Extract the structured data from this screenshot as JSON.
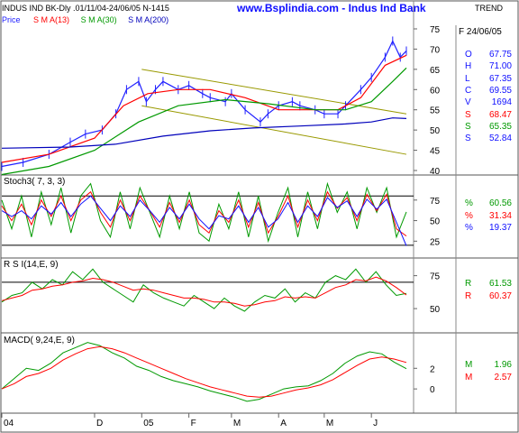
{
  "header": {
    "symbol_line": "INDUS IND BK-Dly .01/11/04-24/06/05  N-1415",
    "site_title": "www.Bsplindia.com - Indus Ind Bank",
    "trend_label": "TREND",
    "legend": [
      {
        "label": "Price",
        "color": "#2020ff"
      },
      {
        "label": "S M A(13)",
        "color": "#ff0000"
      },
      {
        "label": "S M A(30)",
        "color": "#009900"
      },
      {
        "label": "S M A(200)",
        "color": "#0000bb"
      }
    ]
  },
  "readouts": {
    "date": "F 24/06/05",
    "price": [
      {
        "k": "O",
        "v": "67.75",
        "color": "#1010ff"
      },
      {
        "k": "H",
        "v": "71.00",
        "color": "#1010ff"
      },
      {
        "k": "L",
        "v": "67.35",
        "color": "#1010ff"
      },
      {
        "k": "C",
        "v": "69.55",
        "color": "#1010ff"
      },
      {
        "k": "V",
        "v": "1694",
        "color": "#1010ff"
      },
      {
        "k": "S",
        "v": "68.47",
        "color": "#ff0000"
      },
      {
        "k": "S",
        "v": "65.35",
        "color": "#009900"
      },
      {
        "k": "S",
        "v": "52.84",
        "color": "#1010ff"
      }
    ],
    "stoch": [
      {
        "k": "%",
        "v": "60.56",
        "color": "#009900"
      },
      {
        "k": "%",
        "v": "31.34",
        "color": "#ff0000"
      },
      {
        "k": "%",
        "v": "19.37",
        "color": "#1010ff"
      }
    ],
    "rsi": [
      {
        "k": "R",
        "v": "61.53",
        "color": "#009900"
      },
      {
        "k": "R",
        "v": "60.37",
        "color": "#ff0000"
      }
    ],
    "macd": [
      {
        "k": "M",
        "v": "1.96",
        "color": "#009900"
      },
      {
        "k": "M",
        "v": "2.57",
        "color": "#ff0000"
      }
    ]
  },
  "chart_data": [
    {
      "type": "line",
      "panel": "price",
      "title": "www.Bsplindia.com - Indus Ind Bank",
      "ylim": [
        40,
        75
      ],
      "yticks": [
        40,
        45,
        50,
        55,
        60,
        65,
        70,
        75
      ],
      "x_range": [
        "2004-10-01",
        "2005-06-24"
      ],
      "x_tick_labels": [
        "04",
        "D",
        "05",
        "F",
        "M",
        "A",
        "M",
        "J"
      ],
      "grid": false,
      "series": [
        {
          "name": "Price",
          "color": "#2020ff",
          "x": [
            "2004-10-01",
            "2004-10-15",
            "2004-11-01",
            "2004-11-15",
            "2004-11-25",
            "2004-12-06",
            "2004-12-15",
            "2004-12-22",
            "2004-12-30",
            "2005-01-04",
            "2005-01-10",
            "2005-01-15",
            "2005-01-25",
            "2005-02-01",
            "2005-02-10",
            "2005-02-15",
            "2005-02-25",
            "2005-03-01",
            "2005-03-10",
            "2005-03-20",
            "2005-03-25",
            "2005-04-01",
            "2005-04-10",
            "2005-04-15",
            "2005-04-25",
            "2005-05-01",
            "2005-05-10",
            "2005-05-15",
            "2005-05-25",
            "2005-06-01",
            "2005-06-10",
            "2005-06-15",
            "2005-06-20",
            "2005-06-24"
          ],
          "y": [
            41,
            42,
            44,
            47,
            49,
            50,
            54,
            60,
            62,
            57,
            60,
            62,
            60,
            61,
            59,
            58,
            57,
            59,
            55,
            52,
            54,
            56,
            57,
            56,
            55,
            54,
            54,
            56,
            60,
            63,
            68,
            72,
            68,
            69.55
          ]
        },
        {
          "name": "S M A(13)",
          "color": "#ff0000",
          "x": [
            "2004-10-01",
            "2004-11-01",
            "2004-12-01",
            "2004-12-20",
            "2005-01-05",
            "2005-01-25",
            "2005-02-15",
            "2005-03-10",
            "2005-04-01",
            "2005-04-20",
            "2005-05-10",
            "2005-05-25",
            "2005-06-10",
            "2005-06-24"
          ],
          "y": [
            42,
            44,
            48,
            56,
            59,
            60,
            60,
            58,
            55,
            55,
            55,
            58,
            66,
            68.47
          ]
        },
        {
          "name": "S M A(30)",
          "color": "#009900",
          "x": [
            "2004-10-01",
            "2004-11-01",
            "2004-12-01",
            "2004-12-30",
            "2005-01-25",
            "2005-02-25",
            "2005-03-25",
            "2005-04-25",
            "2005-05-15",
            "2005-06-01",
            "2005-06-15",
            "2005-06-24"
          ],
          "y": [
            39,
            41,
            45,
            52,
            56,
            57.5,
            56.5,
            55,
            55,
            57,
            62,
            65.35
          ]
        },
        {
          "name": "S M A(200)",
          "color": "#0000bb",
          "x": [
            "2004-10-01",
            "2004-11-15",
            "2004-12-15",
            "2005-01-15",
            "2005-02-15",
            "2005-03-15",
            "2005-04-15",
            "2005-05-15",
            "2005-06-01",
            "2005-06-15",
            "2005-06-24"
          ],
          "y": [
            45.5,
            45.8,
            46.5,
            48.5,
            49.8,
            50.5,
            51.0,
            51.5,
            52,
            53,
            52.84
          ]
        }
      ],
      "trendlines": [
        {
          "color": "#999900",
          "from": [
            "2005-01-01",
            65
          ],
          "to": [
            "2005-06-24",
            54
          ]
        },
        {
          "color": "#999900",
          "from": [
            "2005-01-01",
            56
          ],
          "to": [
            "2005-06-24",
            44
          ]
        }
      ]
    },
    {
      "type": "line",
      "panel": "stoch",
      "title": "Stoch3( 7, 3, 3)",
      "ylim": [
        10,
        100
      ],
      "yticks": [
        25,
        50,
        75
      ],
      "ref_lines": [
        20,
        80
      ],
      "series": [
        {
          "name": "%",
          "color": "#009900",
          "values": [
            75,
            40,
            80,
            30,
            85,
            45,
            90,
            35,
            80,
            95,
            50,
            30,
            85,
            40,
            90,
            60,
            30,
            80,
            40,
            85,
            35,
            25,
            70,
            40,
            85,
            30,
            80,
            25,
            60,
            90,
            30,
            85,
            40,
            95,
            60,
            85,
            40,
            90,
            60,
            90,
            30,
            60.56
          ]
        },
        {
          "name": "%",
          "color": "#ff0000",
          "values": [
            68,
            50,
            70,
            45,
            75,
            55,
            80,
            50,
            75,
            85,
            60,
            42,
            75,
            50,
            80,
            62,
            42,
            72,
            48,
            75,
            45,
            35,
            62,
            48,
            75,
            42,
            72,
            35,
            55,
            80,
            42,
            75,
            50,
            85,
            65,
            78,
            50,
            82,
            62,
            82,
            40,
            31.34
          ]
        },
        {
          "name": "%",
          "color": "#1010ff",
          "values": [
            62,
            55,
            62,
            52,
            68,
            58,
            72,
            55,
            70,
            80,
            65,
            50,
            68,
            55,
            75,
            62,
            48,
            66,
            52,
            70,
            52,
            40,
            56,
            52,
            68,
            48,
            66,
            42,
            52,
            72,
            48,
            68,
            55,
            78,
            66,
            74,
            55,
            76,
            64,
            76,
            48,
            19.37
          ]
        }
      ]
    },
    {
      "type": "line",
      "panel": "rsi",
      "title": "R S I(14,E, 9)",
      "ylim": [
        35,
        85
      ],
      "yticks": [
        50,
        75
      ],
      "ref_line": 70,
      "series": [
        {
          "name": "R",
          "color": "#009900",
          "values": [
            55,
            60,
            62,
            70,
            65,
            72,
            68,
            78,
            72,
            80,
            70,
            65,
            60,
            55,
            68,
            62,
            58,
            55,
            52,
            60,
            55,
            50,
            58,
            52,
            48,
            55,
            60,
            58,
            65,
            55,
            62,
            58,
            70,
            75,
            72,
            80,
            70,
            78,
            68,
            60,
            61.53
          ]
        },
        {
          "name": "R",
          "color": "#ff0000",
          "values": [
            56,
            58,
            60,
            64,
            65,
            67,
            68,
            70,
            71,
            73,
            72,
            70,
            67,
            64,
            65,
            64,
            62,
            60,
            58,
            58,
            57,
            55,
            55,
            54,
            52,
            53,
            55,
            56,
            59,
            58,
            59,
            58,
            62,
            66,
            68,
            72,
            71,
            74,
            71,
            66,
            60.37
          ]
        }
      ]
    },
    {
      "type": "line",
      "panel": "macd",
      "title": "MACD( 9,24,E, 9)",
      "ylim": [
        -2,
        5
      ],
      "yticks": [
        0,
        2
      ],
      "series": [
        {
          "name": "M",
          "color": "#009900",
          "values": [
            0,
            1,
            2,
            1.8,
            2.5,
            3.5,
            4.0,
            4.5,
            4.2,
            3.5,
            3.0,
            2.2,
            1.8,
            1.2,
            0.8,
            0.5,
            0.2,
            -0.2,
            -0.5,
            -0.8,
            -1.2,
            -1.0,
            -0.5,
            0.0,
            0.2,
            0.3,
            0.8,
            1.5,
            2.5,
            3.2,
            3.6,
            3.4,
            2.6,
            1.96
          ]
        },
        {
          "name": "M",
          "color": "#ff0000",
          "values": [
            0,
            0.5,
            1.2,
            1.5,
            2.0,
            2.8,
            3.4,
            3.9,
            4.1,
            3.9,
            3.5,
            3.0,
            2.5,
            2.0,
            1.5,
            1.0,
            0.6,
            0.2,
            -0.1,
            -0.4,
            -0.7,
            -0.8,
            -0.7,
            -0.4,
            -0.1,
            0.1,
            0.4,
            0.9,
            1.6,
            2.3,
            2.9,
            3.1,
            2.9,
            2.57
          ]
        }
      ]
    }
  ]
}
